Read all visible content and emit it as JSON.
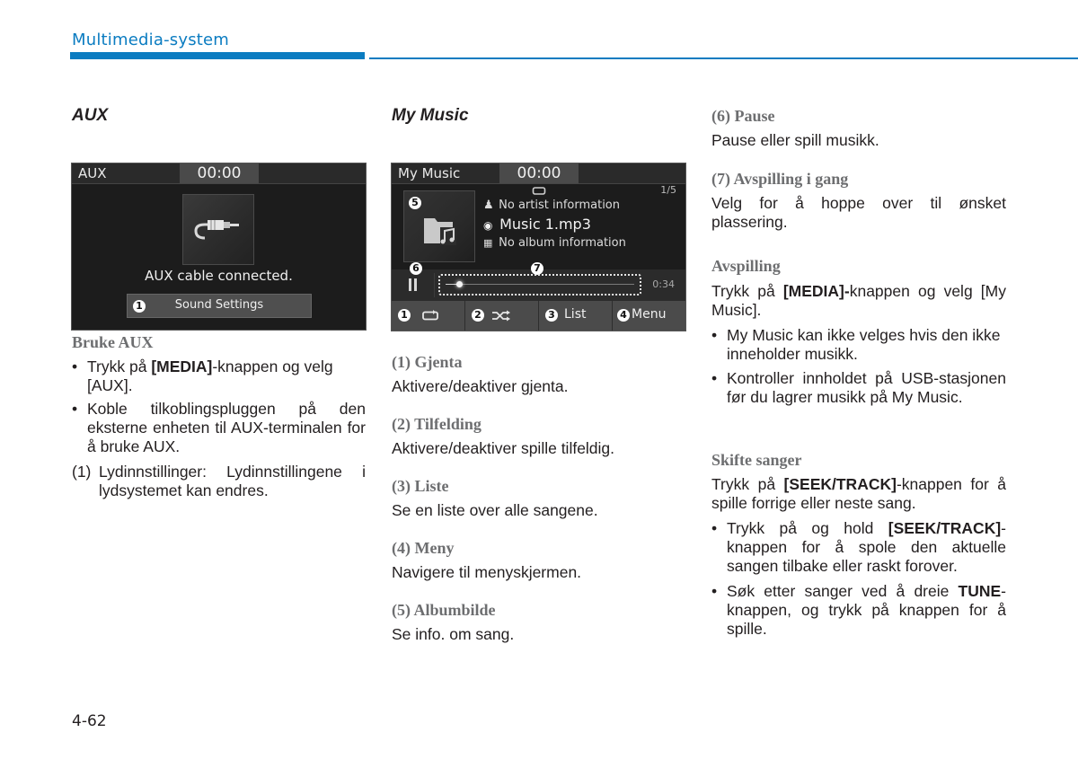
{
  "header": {
    "section_title": "Multimedia-system",
    "accent_color": "#0b7cc1"
  },
  "aux": {
    "title": "AUX",
    "screen": {
      "mode_label": "AUX",
      "clock": "00:00",
      "icon": "aux-cable-icon",
      "status": "AUX cable connected.",
      "button_number": "1",
      "button_label": "Sound Settings"
    },
    "subheading": "Bruke AUX",
    "bullets": [
      {
        "pre": "Trykk på ",
        "bold": "[MEDIA]",
        "post": "-knappen og velg [AUX]."
      },
      {
        "pre": "Koble tilkoblingspluggen på den eksterne enheten til AUX-terminalen for å bruke AUX.",
        "bold": "",
        "post": ""
      }
    ],
    "note_number": "(1)",
    "note_text": "Lydinnstillinger: Lydinnstillingene i lydsystemet kan endres."
  },
  "mymusic": {
    "title": "My Music",
    "screen": {
      "mode_label": "My Music",
      "clock": "00:00",
      "track_count": "1/5",
      "artist": "No artist information",
      "song": "Music 1.mp3",
      "album": "No album information",
      "elapsed": "0:34",
      "progress_fraction": 0.07,
      "callouts": {
        "album_art": "5",
        "pause": "6",
        "progress": "7"
      },
      "buttons": [
        {
          "number": "1",
          "label": "",
          "icon": "repeat-icon"
        },
        {
          "number": "2",
          "label": "",
          "icon": "shuffle-icon"
        },
        {
          "number": "3",
          "label": "List",
          "icon": ""
        },
        {
          "number": "4",
          "label": "Menu",
          "icon": ""
        }
      ]
    },
    "items": [
      {
        "heading": "(1) Gjenta",
        "text": "Aktivere/deaktiver gjenta."
      },
      {
        "heading": "(2) Tilfelding",
        "text": "Aktivere/deaktiver spille tilfeldig."
      },
      {
        "heading": "(3) Liste",
        "text": "Se en liste over alle sangene."
      },
      {
        "heading": "(4) Meny",
        "text": "Navigere til menyskjermen."
      },
      {
        "heading": "(5) Albumbilde",
        "text": "Se info. om sang."
      }
    ]
  },
  "right": {
    "items": [
      {
        "heading": "(6) Pause",
        "text": "Pause eller spill musikk."
      },
      {
        "heading": "(7) Avspilling i gang",
        "text": "Velg for å hoppe over til ønsket plassering."
      }
    ],
    "playback": {
      "heading": "Avspilling",
      "intro_pre": "Trykk på ",
      "intro_bold": "[MEDIA]-",
      "intro_post": "knappen og velg [My Music].",
      "bullets": [
        "My Music kan ikke velges hvis den ikke inneholder musikk.",
        "Kontroller innholdet på USB-stasjonen før du lagrer musikk på My Music."
      ]
    },
    "change_songs": {
      "heading": "Skifte sanger",
      "intro_pre": "Trykk på ",
      "intro_bold": "[SEEK/TRACK]",
      "intro_post": "-knappen for å spille forrige eller neste sang.",
      "bullets": [
        {
          "pre": "Trykk på og hold ",
          "bold": "[SEEK/TRACK]",
          "post": "-knappen for å spole den aktuelle sangen tilbake eller raskt forover."
        },
        {
          "pre": "Søk etter sanger ved å dreie ",
          "bold": "TUNE",
          "post": "-knappen, og trykk på knappen for å spille."
        }
      ]
    }
  },
  "footer": {
    "page_number": "4-62"
  }
}
